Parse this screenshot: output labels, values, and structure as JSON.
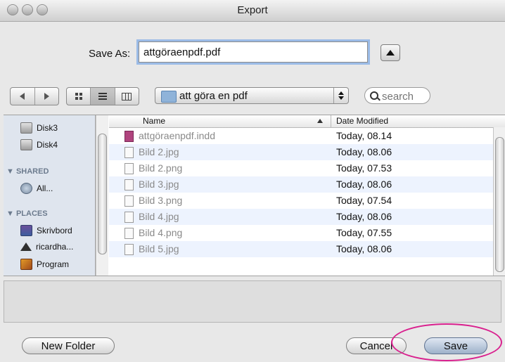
{
  "window": {
    "title": "Export"
  },
  "save_as": {
    "label": "Save As:",
    "value": "attgöraenpdf.pdf"
  },
  "toolbar": {
    "back_icon": "left-arrow-icon",
    "forward_icon": "right-arrow-icon",
    "views": [
      "icon-view-icon",
      "list-view-icon",
      "column-view-icon"
    ],
    "folder": "att göra en pdf",
    "search_placeholder": "search"
  },
  "sidebar": {
    "devices": [
      "Disk3",
      "Disk4"
    ],
    "shared_heading": "SHARED",
    "shared": [
      "All..."
    ],
    "places_heading": "PLACES",
    "places": [
      "Skrivbord",
      "ricardha...",
      "Program"
    ]
  },
  "list": {
    "columns": {
      "name": "Name",
      "date": "Date Modified"
    },
    "rows": [
      {
        "name": "attgöraenpdf.indd",
        "date": "Today, 08.14"
      },
      {
        "name": "Bild 2.jpg",
        "date": "Today, 08.06"
      },
      {
        "name": "Bild 2.png",
        "date": "Today, 07.53"
      },
      {
        "name": "Bild 3.jpg",
        "date": "Today, 08.06"
      },
      {
        "name": "Bild 3.png",
        "date": "Today, 07.54"
      },
      {
        "name": "Bild 4.jpg",
        "date": "Today, 08.06"
      },
      {
        "name": "Bild 4.png",
        "date": "Today, 07.55"
      },
      {
        "name": "Bild 5.jpg",
        "date": "Today, 08.06"
      }
    ]
  },
  "buttons": {
    "new_folder": "New Folder",
    "cancel": "Cancel",
    "save": "Save"
  },
  "colors": {
    "highlight": "#d9208e",
    "alt_row": "#edf3fe",
    "sidebar": "#dfe5ee"
  }
}
